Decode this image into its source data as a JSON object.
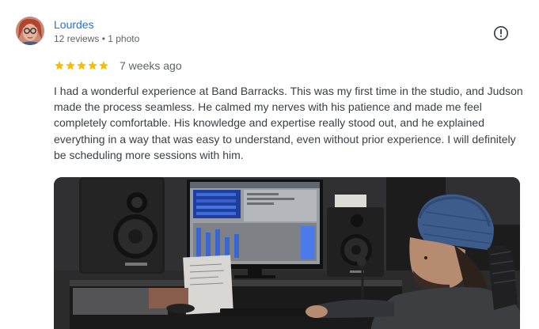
{
  "reviewer": {
    "name": "Lourdes",
    "stats": "12 reviews • 1 photo"
  },
  "rating": {
    "stars": 5,
    "max": 5,
    "date": "7 weeks ago"
  },
  "review_text": "I had a wonderful experience at Band Barracks. This was my first time in the studio, and Judson made the process seamless. He calmed my nerves with his patience and made me feel completely comfortable. His knowledge and expertise really stood out, and he explained everything in a way that was easy to understand, even without prior experience. I will definitely be scheduling more sessions with him.",
  "icons": {
    "report": "report-flag-icon",
    "star": "star-icon"
  },
  "colors": {
    "name": "#1a73e8",
    "star": "#fbbc04",
    "meta": "#5f6368",
    "text": "#3c4043"
  }
}
